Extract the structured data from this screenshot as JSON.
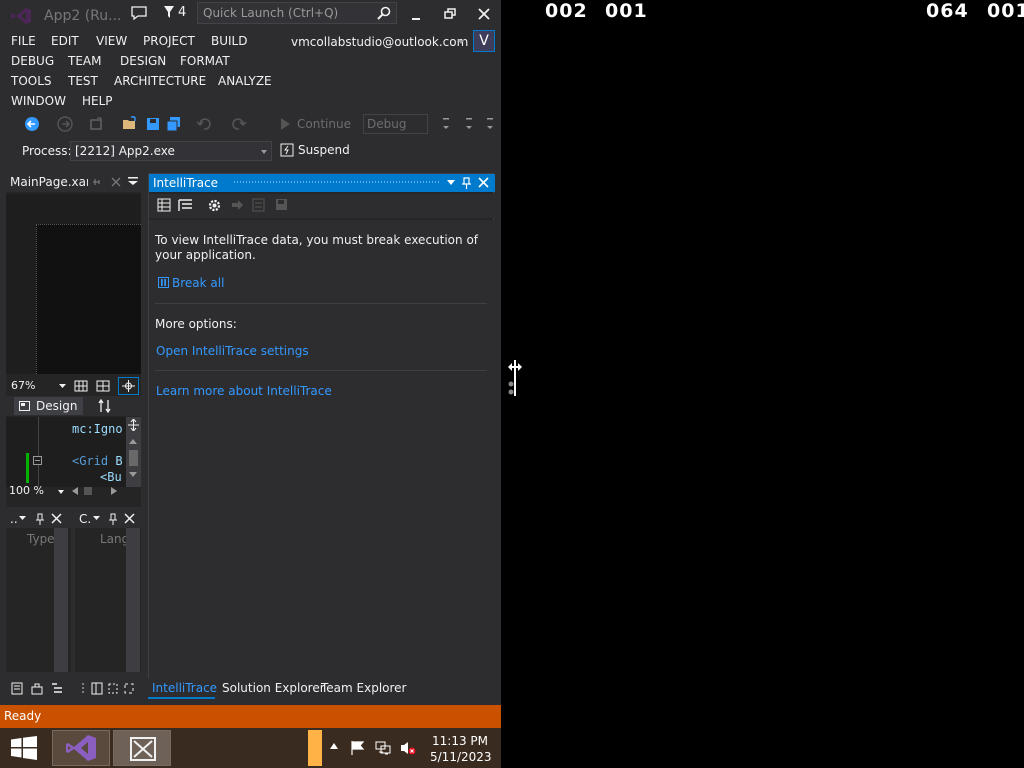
{
  "window": {
    "title": "App2 (Ru...",
    "notification_count": "4",
    "quick_launch_placeholder": "Quick Launch (Ctrl+Q)",
    "account": "vmcollabstudio@outlook.com",
    "account_badge": "V"
  },
  "menu": {
    "row1": [
      "FILE",
      "EDIT",
      "VIEW",
      "PROJECT",
      "BUILD"
    ],
    "row2": [
      "DEBUG",
      "TEAM",
      "DESIGN",
      "FORMAT"
    ],
    "row3": [
      "TOOLS",
      "TEST",
      "ARCHITECTURE",
      "ANALYZE"
    ],
    "row4": [
      "WINDOW",
      "HELP"
    ]
  },
  "toolbar": {
    "continue_label": "Continue",
    "config_value": "Debug"
  },
  "process_bar": {
    "label": "Process:",
    "process_value": "[2212] App2.exe",
    "suspend_label": "Suspend"
  },
  "designer": {
    "doc_tab": "MainPage.xaml",
    "zoom": "67%",
    "design_tab": "Design",
    "code_line1": "mc:Igno",
    "code_line2_tag": "<Grid",
    "code_line2_rest": " B",
    "code_line3": "<Bu",
    "code_zoom": "100 %"
  },
  "tool_windows": {
    "left_header": "..",
    "left_column": "Type",
    "right_header": "C.",
    "right_column": "Lang"
  },
  "intellitrace": {
    "title": "IntelliTrace",
    "message": "To view IntelliTrace data, you must break execution of your application.",
    "break_all": "Break all",
    "more_options": "More options:",
    "open_settings": "Open IntelliTrace settings",
    "learn_more": "Learn more about IntelliTrace"
  },
  "bottom_tabs": [
    "IntelliTrace",
    "Solution Explorer",
    "Team Explorer"
  ],
  "status": {
    "text": "Ready"
  },
  "taskbar": {
    "time": "11:13 PM",
    "date": "5/11/2023"
  },
  "overlay": {
    "counter_a1": "002",
    "counter_a2": "001",
    "counter_b1": "064",
    "counter_b2": "001"
  },
  "colors": {
    "accent": "#007acc",
    "status_bar": "#ca5100",
    "link": "#3399ff",
    "background": "#2d2d30"
  }
}
